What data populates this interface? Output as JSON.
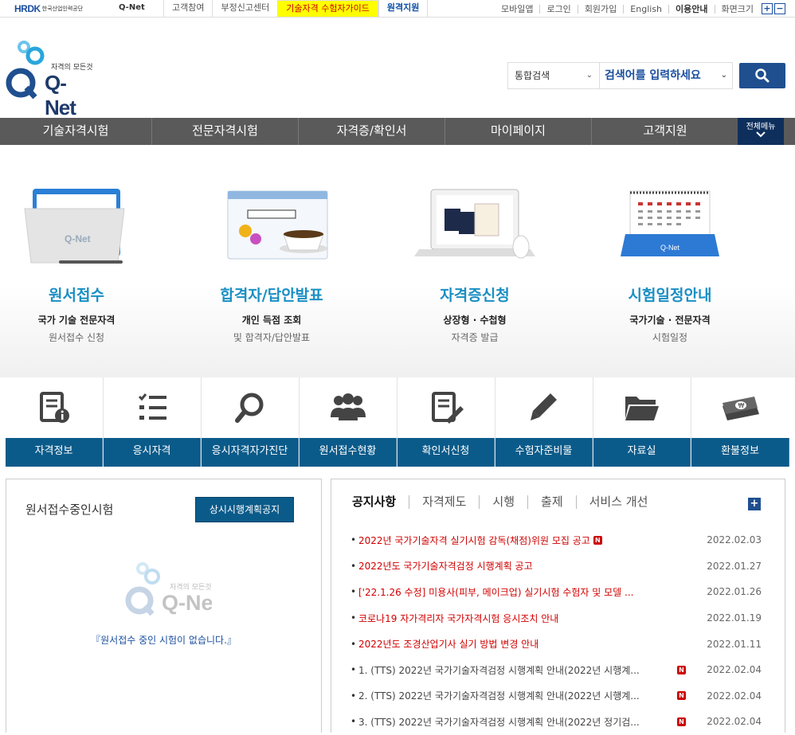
{
  "topbar": {
    "hrdk_logo": "HRDK",
    "hrdk_sub": "한국산업인력공단",
    "qnet_small": "Q-Net",
    "links": [
      "고객참여",
      "부정신고센터",
      "기술자격 수험자가이드",
      "원격지원"
    ],
    "right_links": [
      "모바일앱",
      "로그인",
      "회원가입",
      "English",
      "이용안내",
      "화면크기"
    ],
    "zoom_in": "+",
    "zoom_out": "−"
  },
  "header": {
    "logo_tagline": "자격의 모든것",
    "logo_text": "Q-Net",
    "search_category": "통합검색",
    "search_placeholder": "검색어를 입력하세요"
  },
  "gnb": {
    "items": [
      "기술자격시험",
      "전문자격시험",
      "자격증/확인서",
      "마이페이지",
      "고객지원"
    ],
    "all_menu": "전체메뉴"
  },
  "services": [
    {
      "title": "원서접수",
      "line1": "국가 기술 전문자격",
      "line2": "원서접수 신청"
    },
    {
      "title": "합격자/답안발표",
      "line1": "개인 득점 조회",
      "line2": "및 합격자/답안발표"
    },
    {
      "title": "자격증신청",
      "line1": "상장형 · 수첩형",
      "line2": "자격증 발급"
    },
    {
      "title": "시험일정안내",
      "line1": "국가기술 · 전문자격",
      "line2": "시험일정"
    }
  ],
  "quick_menu": [
    "자격정보",
    "응시자격",
    "응시자격자가진단",
    "원서접수현황",
    "확인서신청",
    "수험자준비물",
    "자료실",
    "환불정보"
  ],
  "left_panel": {
    "title": "원서접수중인시험",
    "button": "상시시행계획공지",
    "logo_tagline": "자격의 모든것",
    "logo_text": "Q-Net",
    "empty_message": "『원서접수 중인 시험이 없습니다.』"
  },
  "right_panel": {
    "tabs": [
      "공지사항",
      "자격제도",
      "시행",
      "출제",
      "서비스 개선"
    ],
    "more": "+",
    "notices": [
      {
        "bullet": "•",
        "title": "2022년 국가기술자격 실기시험 감독(채점)위원 모집 공고",
        "badge": "N",
        "date": "2022.02.03",
        "style": "red"
      },
      {
        "bullet": "•",
        "title": "2022년도 국가기술자격검정 시행계획 공고",
        "badge": "",
        "date": "2022.01.27",
        "style": "red"
      },
      {
        "bullet": "•",
        "title": "['22.1.26 수정] 미용사(피부, 메이크업) 실기시험 수험자 및 모델 ...",
        "badge": "",
        "date": "2022.01.26",
        "style": "red"
      },
      {
        "bullet": "•",
        "title": "코로나19 자가격리자 국가자격시험 응시조치 안내",
        "badge": "",
        "date": "2022.01.19",
        "style": "red"
      },
      {
        "bullet": "•",
        "title": "2022년도 조경산업기사 실기 방법 변경 안내",
        "badge": "",
        "date": "2022.01.11",
        "style": "red"
      },
      {
        "bullet": "•",
        "title": "1. (TTS) 2022년 국가기술자격검정 시행계획 안내(2022년 시행계...",
        "badge": "N",
        "date": "2022.02.04",
        "style": "gray"
      },
      {
        "bullet": "•",
        "title": "2. (TTS) 2022년 국가기술자격검정 시행계획 안내(2022년 시행계...",
        "badge": "N",
        "date": "2022.02.04",
        "style": "gray"
      },
      {
        "bullet": "•",
        "title": "3. (TTS) 2022년 국가기술자격검정 시행계획 안내(2022년 정기검...",
        "badge": "N",
        "date": "2022.02.04",
        "style": "gray"
      }
    ]
  },
  "colors": {
    "gnb_bg": "#5a5a5a",
    "quick_label_bg": "#0b5b8a",
    "accent_blue": "#1a8fc4",
    "notice_red": "#d10000",
    "highlight_yellow": "#ffff00"
  }
}
